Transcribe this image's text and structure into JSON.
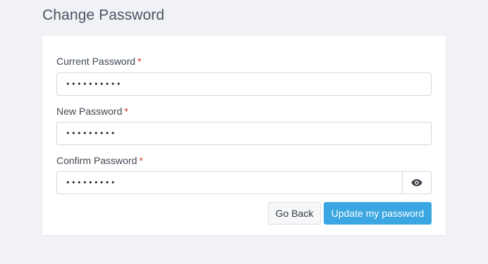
{
  "page": {
    "title": "Change Password"
  },
  "form": {
    "fields": [
      {
        "label": "Current Password",
        "required_mark": "*",
        "value": "••••••••••"
      },
      {
        "label": "New Password",
        "required_mark": "*",
        "value": "•••••••••"
      },
      {
        "label": "Confirm Password",
        "required_mark": "*",
        "value": "•••••••••"
      }
    ],
    "toggle_visibility_icon": "eye-icon",
    "buttons": {
      "back_label": "Go Back",
      "submit_label": "Update my password"
    }
  },
  "colors": {
    "accent": "#3aa6e2",
    "required": "#d0342c",
    "background": "#f0f2f5"
  }
}
